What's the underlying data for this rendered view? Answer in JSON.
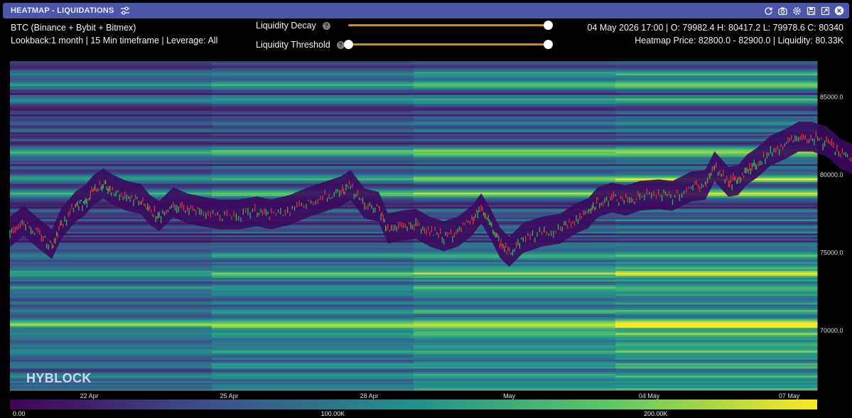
{
  "window": {
    "title": "HEATMAP - LIQUIDATIONS",
    "tools": [
      "refresh-icon",
      "camera-icon",
      "gear-icon",
      "save-icon",
      "expand-icon",
      "close-icon"
    ]
  },
  "info": {
    "line1": "BTC (Binance + Bybit + Bitmex)",
    "line2": "Lookback:1 month | 15 Min timeframe | Leverage: All",
    "ohlc": "04 May 2026 17:00 | O: 79982.4 H: 80417.2 L: 79978.6 C: 80340",
    "heatmap": "Heatmap Price: 82800.0 - 82900.0 | Liquidity: 80.33K"
  },
  "controls": {
    "decay_label": "Liquidity Decay",
    "decay_value": 1.0,
    "threshold_label": "Liquidity Threshold",
    "threshold_low": 0.0,
    "threshold_high": 1.0,
    "help_glyph": "?"
  },
  "watermark": "HYBLOCK",
  "colors": {
    "background": "#000000",
    "titlebar": "#4c55a6",
    "slider": "#c98a2a",
    "heat_low": "#440154",
    "heat_mid": "#21918c",
    "heat_high": "#e8e419",
    "candle_up": "#3fb950",
    "candle_down": "#e0392b"
  },
  "chart_data": {
    "type": "heatmap",
    "y_ticks": [
      "85000.0",
      "80000.0",
      "75000.0",
      "70000.0"
    ],
    "y_tick_values": [
      85000,
      80000,
      75000,
      70000
    ],
    "ylim": [
      66200,
      87300
    ],
    "x_ticks": [
      "22 Apr",
      "25 Apr",
      "28 Apr",
      "May",
      "04 May",
      "07 May"
    ],
    "x_tick_days": [
      1.7,
      4.7,
      7.7,
      10.7,
      13.7,
      16.7
    ],
    "xlim_days": [
      0,
      17.3
    ],
    "legend_ticks": [
      "0.00",
      "100.00K",
      "200.00K"
    ],
    "legend_range": [
      0,
      250000
    ],
    "price_path": [
      [
        0.0,
        76300
      ],
      [
        0.3,
        77000
      ],
      [
        0.6,
        76200
      ],
      [
        0.9,
        75500
      ],
      [
        1.1,
        76800
      ],
      [
        1.4,
        77900
      ],
      [
        1.6,
        78300
      ],
      [
        1.8,
        79000
      ],
      [
        2.0,
        79400
      ],
      [
        2.2,
        79000
      ],
      [
        2.5,
        78600
      ],
      [
        2.8,
        78400
      ],
      [
        3.0,
        77700
      ],
      [
        3.2,
        77300
      ],
      [
        3.5,
        78200
      ],
      [
        3.8,
        77800
      ],
      [
        4.1,
        77600
      ],
      [
        4.5,
        77400
      ],
      [
        4.9,
        77400
      ],
      [
        5.3,
        77600
      ],
      [
        5.6,
        77400
      ],
      [
        6.0,
        77700
      ],
      [
        6.4,
        78200
      ],
      [
        6.8,
        78600
      ],
      [
        7.1,
        78900
      ],
      [
        7.3,
        79300
      ],
      [
        7.6,
        78100
      ],
      [
        7.9,
        77900
      ],
      [
        8.1,
        76500
      ],
      [
        8.4,
        76700
      ],
      [
        8.7,
        76800
      ],
      [
        9.0,
        76300
      ],
      [
        9.3,
        76000
      ],
      [
        9.6,
        76300
      ],
      [
        9.9,
        77000
      ],
      [
        10.1,
        77800
      ],
      [
        10.3,
        76800
      ],
      [
        10.5,
        75600
      ],
      [
        10.7,
        75000
      ],
      [
        11.0,
        75900
      ],
      [
        11.4,
        76300
      ],
      [
        11.8,
        76500
      ],
      [
        12.1,
        77100
      ],
      [
        12.4,
        77500
      ],
      [
        12.6,
        78200
      ],
      [
        12.9,
        78500
      ],
      [
        13.2,
        78300
      ],
      [
        13.5,
        78600
      ],
      [
        13.9,
        78700
      ],
      [
        14.2,
        78600
      ],
      [
        14.6,
        79200
      ],
      [
        14.9,
        79300
      ],
      [
        15.1,
        80500
      ],
      [
        15.4,
        79500
      ],
      [
        15.6,
        79600
      ],
      [
        15.8,
        80300
      ],
      [
        16.0,
        80700
      ],
      [
        16.3,
        81500
      ],
      [
        16.6,
        81900
      ],
      [
        16.9,
        82400
      ],
      [
        17.2,
        82400
      ],
      [
        17.5,
        82100
      ],
      [
        17.8,
        81300
      ],
      [
        18.1,
        80900
      ],
      [
        18.4,
        81700
      ],
      [
        18.7,
        82800
      ],
      [
        19.0,
        81600
      ],
      [
        19.3,
        81300
      ],
      [
        19.5,
        81700
      ],
      [
        19.7,
        81400
      ]
    ]
  }
}
